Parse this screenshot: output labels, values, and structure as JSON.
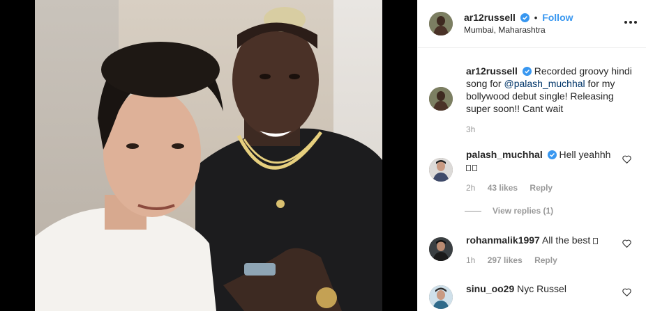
{
  "post": {
    "username": "ar12russell",
    "follow_label": "Follow",
    "separator": "•",
    "location": "Mumbai, Maharashtra",
    "caption_text": "Recorded groovy hindi song for",
    "caption_mention": "@palash_muchhal",
    "caption_rest": "for my bollywood debut single! Releasing super soon!! Cant wait",
    "caption_time": "3h"
  },
  "comments": [
    {
      "username": "palash_muchhal",
      "text": "Hell yeahhh",
      "time": "2h",
      "likes": "43 likes",
      "reply_label": "Reply",
      "view_replies": "View replies (1)"
    },
    {
      "username": "rohanmalik1997",
      "text": "All the best",
      "time": "1h",
      "likes": "297 likes",
      "reply_label": "Reply"
    },
    {
      "username": "sinu_oo29",
      "text": "Nyc Russel"
    }
  ],
  "icons": {
    "verified": "verified-badge-icon",
    "heart": "heart-outline-icon",
    "more": "more-options-icon"
  },
  "colors": {
    "accent": "#3897f0",
    "mention": "#003569",
    "muted": "#999999"
  }
}
